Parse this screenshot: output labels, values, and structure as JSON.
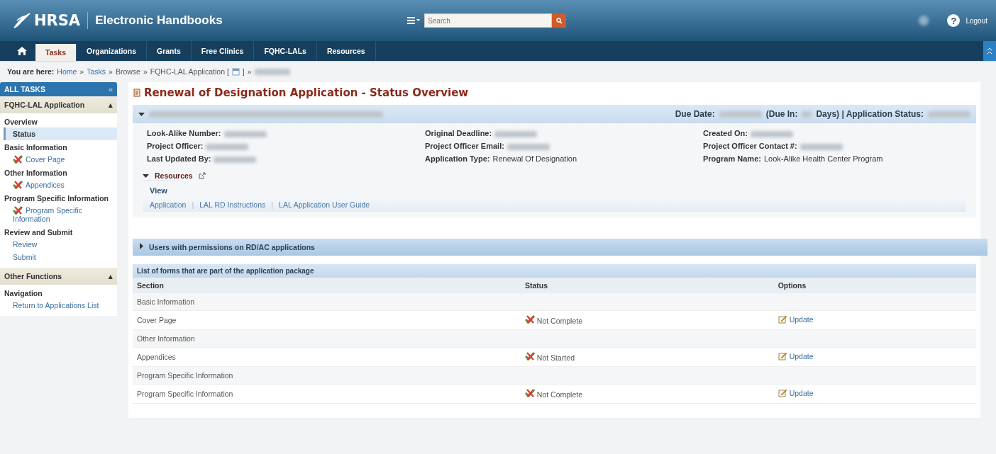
{
  "header": {
    "logo": "HRSA",
    "title": "Electronic Handbooks",
    "search": {
      "placeholder": "Search"
    },
    "user_redacted": true,
    "help": "?",
    "logout": "Logout"
  },
  "nav": {
    "tabs": [
      {
        "label": "Tasks",
        "selected": true
      },
      {
        "label": "Organizations",
        "selected": false
      },
      {
        "label": "Grants",
        "selected": false
      },
      {
        "label": "Free Clinics",
        "selected": false
      },
      {
        "label": "FQHC-LALs",
        "selected": false
      },
      {
        "label": "Resources",
        "selected": false
      }
    ]
  },
  "breadcrumb": {
    "label": "You are here:",
    "separator": "»",
    "items": [
      {
        "text": "Home",
        "kind": "link"
      },
      {
        "text": "Tasks",
        "kind": "link"
      },
      {
        "text": "Browse",
        "kind": "text"
      },
      {
        "text": "FQHC-LAL Application [",
        "kind": "text",
        "icon": true,
        "after": "]"
      },
      {
        "kind": "redacted"
      }
    ]
  },
  "sidebar": {
    "title": "ALL TASKS",
    "collapse": "«",
    "panels": [
      {
        "title": "FQHC-LAL Application",
        "toggle": "▴",
        "groups": [
          {
            "title": "Overview",
            "items": [
              {
                "label": "Status",
                "kind": "link",
                "selected": true
              }
            ]
          },
          {
            "title": "Basic Information",
            "items": [
              {
                "label": "Cover Page",
                "kind": "form",
                "selected": false
              }
            ]
          },
          {
            "title": "Other Information",
            "items": [
              {
                "label": "Appendices",
                "kind": "form",
                "selected": false
              }
            ]
          },
          {
            "title": "Program Specific Information",
            "items": [
              {
                "label": "Program Specific Information",
                "kind": "form",
                "selected": false
              }
            ]
          },
          {
            "title": "Review and Submit",
            "items": [
              {
                "label": "Review",
                "kind": "link",
                "selected": false
              },
              {
                "label": "Submit",
                "kind": "link",
                "selected": false
              }
            ]
          }
        ]
      },
      {
        "title": "Other Functions",
        "toggle": "▴",
        "groups": [
          {
            "title": "Navigation",
            "items": [
              {
                "label": "Return to Applications List",
                "kind": "link",
                "selected": false
              }
            ]
          }
        ]
      }
    ]
  },
  "main": {
    "title": "Renewal of Designation Application - Status Overview",
    "summary": {
      "expanded": true,
      "due_label": "Due Date:",
      "due_in_label": "(Due In:",
      "days_label": "Days) | Application Status:",
      "fields": [
        {
          "label": "Look-Alike Number:",
          "redacted": true
        },
        {
          "label": "Original Deadline:",
          "redacted": true
        },
        {
          "label": "Created On:",
          "redacted": true
        },
        {
          "label": "Project Officer:",
          "redacted": true
        },
        {
          "label": "Project Officer Email:",
          "redacted": true
        },
        {
          "label": "Project Officer Contact #:",
          "redacted": true
        },
        {
          "label": "Last Updated By:",
          "redacted": true
        },
        {
          "label": "Application Type:",
          "value": "Renewal Of Designation"
        },
        {
          "label": "Program Name:",
          "value": "Look-Alike Health Center Program"
        }
      ],
      "resources": {
        "title": "Resources",
        "expanded": true,
        "tab": "View",
        "separator": "|",
        "links": [
          "Application",
          "LAL RD Instructions",
          "LAL Application User Guide"
        ]
      }
    },
    "users_panel": {
      "title": "Users with permissions on RD/AC applications",
      "expanded": false
    },
    "forms": {
      "title": "List of forms that are part of the application package",
      "columns": [
        "Section",
        "Status",
        "Options"
      ],
      "rows": [
        {
          "kind": "group",
          "section": "Basic Information"
        },
        {
          "kind": "form",
          "section": "Cover Page",
          "status": "Not Complete",
          "option": "Update"
        },
        {
          "kind": "group",
          "section": "Other Information"
        },
        {
          "kind": "form",
          "section": "Appendices",
          "status": "Not Started",
          "option": "Update"
        },
        {
          "kind": "group",
          "section": "Program Specific Information"
        },
        {
          "kind": "form",
          "section": "Program Specific Information",
          "status": "Not Complete",
          "option": "Update"
        }
      ]
    }
  }
}
